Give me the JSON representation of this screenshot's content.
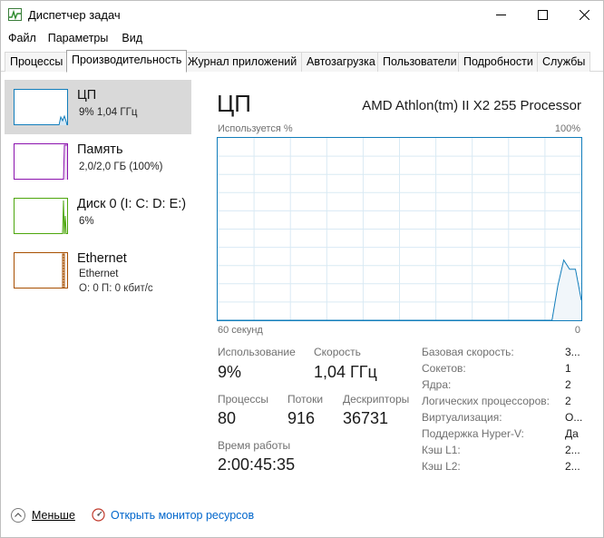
{
  "window": {
    "title": "Диспетчер задач"
  },
  "menu": [
    "Файл",
    "Параметры",
    "Вид"
  ],
  "tabs": [
    "Процессы",
    "Производительность",
    "Журнал приложений",
    "Автозагрузка",
    "Пользователи",
    "Подробности",
    "Службы"
  ],
  "active_tab": "Производительность",
  "sidebar": [
    {
      "name": "ЦП",
      "sub1": "9% 1,04 ГГц",
      "sub2": "",
      "color": "#117dbb",
      "icon": "cpu-mini-graph"
    },
    {
      "name": "Память",
      "sub1": "2,0/2,0 ГБ (100%)",
      "sub2": "",
      "color": "#8b12ae",
      "icon": "memory-mini-graph"
    },
    {
      "name": "Диск 0 (I: C: D: E:)",
      "sub1": "6%",
      "sub2": "",
      "color": "#4da60c",
      "icon": "disk-mini-graph"
    },
    {
      "name": "Ethernet",
      "sub1": "Ethernet",
      "sub2": "О: 0 П: 0 кбит/с",
      "color": "#a74f01",
      "icon": "ethernet-mini-graph"
    }
  ],
  "cpu": {
    "title": "ЦП",
    "model": "AMD Athlon(tm) II X2 255 Processor",
    "graph_top_left": "Используется %",
    "graph_top_right": "100%",
    "graph_bottom_left": "60 секунд",
    "graph_bottom_right": "0",
    "usage_label": "Использование",
    "usage_value": "9%",
    "speed_label": "Скорость",
    "speed_value": "1,04 ГГц",
    "processes_label": "Процессы",
    "processes_value": "80",
    "threads_label": "Потоки",
    "threads_value": "916",
    "handles_label": "Дескрипторы",
    "handles_value": "36731",
    "uptime_label": "Время работы",
    "uptime_value": "2:00:45:35"
  },
  "cpu_info": [
    {
      "key": "Базовая скорость:",
      "value": "3..."
    },
    {
      "key": "Сокетов:",
      "value": "1"
    },
    {
      "key": "Ядра:",
      "value": "2"
    },
    {
      "key": "Логических процессоров:",
      "value": "2"
    },
    {
      "key": "Виртуализация:",
      "value": "О..."
    },
    {
      "key": "Поддержка Hyper-V:",
      "value": "Да"
    },
    {
      "key": "Кэш L1:",
      "value": "2..."
    },
    {
      "key": "Кэш L2:",
      "value": "2..."
    }
  ],
  "chart_data": {
    "type": "area",
    "x": [
      0,
      1,
      2,
      3,
      4,
      5,
      6,
      7,
      8,
      9,
      10,
      11,
      12,
      13,
      14,
      15,
      16,
      17,
      18,
      19,
      20,
      21,
      22,
      23,
      24,
      25,
      26,
      27,
      28,
      29,
      30,
      31,
      32,
      33,
      34,
      35,
      36,
      37,
      38,
      39,
      40,
      41,
      42,
      43,
      44,
      45,
      46,
      47,
      48,
      49,
      50,
      51,
      52,
      53,
      54,
      55,
      56,
      57,
      58,
      59,
      60
    ],
    "values": [
      0,
      0,
      0,
      0,
      0,
      0,
      0,
      0,
      0,
      0,
      0,
      0,
      0,
      0,
      0,
      0,
      0,
      0,
      0,
      0,
      0,
      0,
      0,
      0,
      0,
      0,
      0,
      0,
      0,
      0,
      0,
      0,
      0,
      0,
      0,
      0,
      0,
      0,
      0,
      0,
      0,
      0,
      0,
      0,
      0,
      0,
      0,
      0,
      0,
      0,
      0,
      0,
      0,
      0,
      0,
      0,
      0,
      0,
      19,
      33,
      28,
      28,
      11
    ],
    "ylim": [
      0,
      100
    ],
    "xlim": [
      0,
      62
    ],
    "color": "#117dbb",
    "grid": true
  },
  "footer": {
    "less_label": "Меньше",
    "resmon_label": "Открыть монитор ресурсов"
  }
}
